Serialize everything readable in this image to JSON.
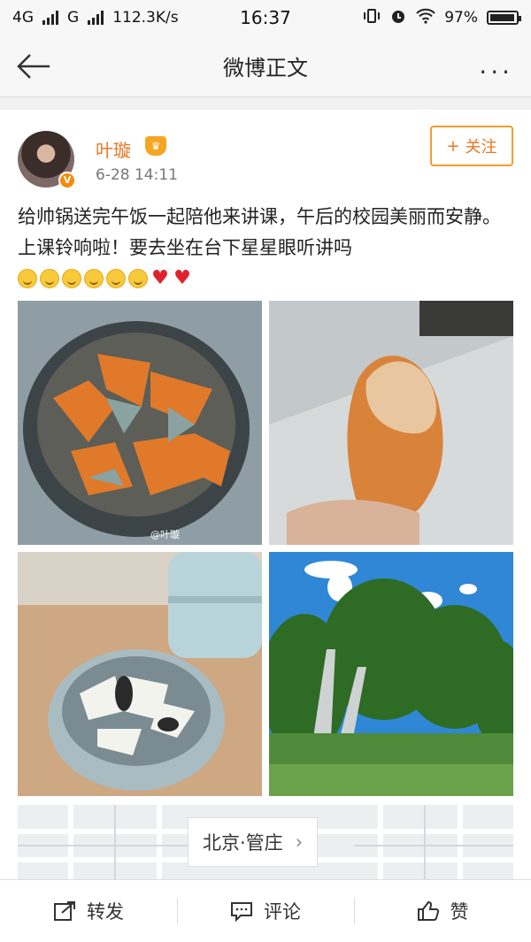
{
  "status_bar": {
    "net1": "4G",
    "net2": "G",
    "speed": "112.3K/s",
    "time": "16:37",
    "battery": "97%",
    "battery_level": 0.97
  },
  "nav": {
    "title": "微博正文",
    "more": "..."
  },
  "post": {
    "username": "叶璇",
    "time": "6-28 14:11",
    "follow_label": "关注",
    "follow_plus": "+",
    "text": "给帅锅送完午饭一起陪他来讲课，午后的校园美丽而安静。上课铃响啦！要去坐在台下星星眼听讲吗",
    "watermark": "@叶璇",
    "location": "北京·管庄",
    "location_arrow": "›"
  },
  "actions": {
    "repost": "转发",
    "comment": "评论",
    "like": "赞"
  }
}
